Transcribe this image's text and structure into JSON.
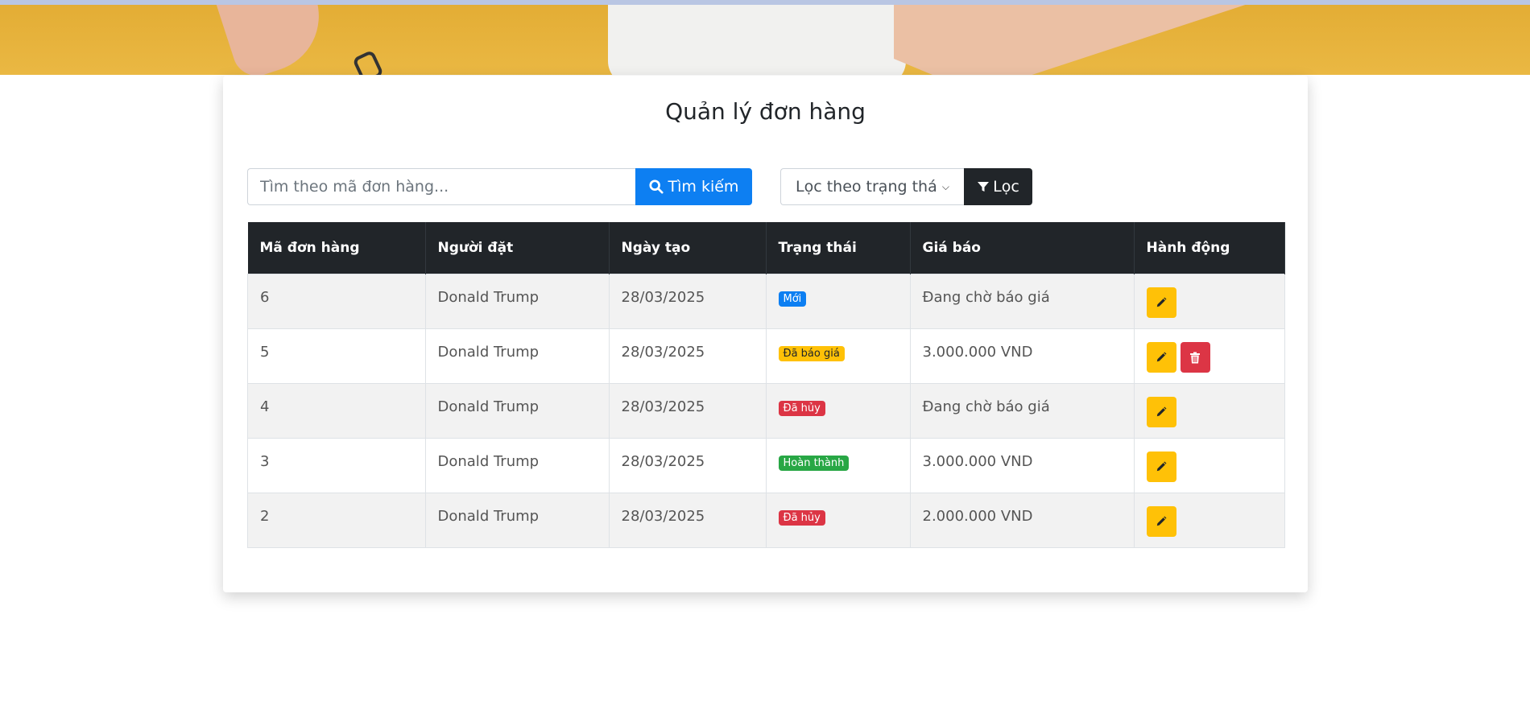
{
  "page": {
    "title": "Quản lý đơn hàng"
  },
  "search": {
    "placeholder": "Tìm theo mã đơn hàng...",
    "button_label": "Tìm kiếm",
    "icon": "search-icon"
  },
  "filter": {
    "selected": "Lọc theo trạng thái",
    "button_label": "Lọc",
    "icon": "filter-icon"
  },
  "table": {
    "headers": [
      "Mã đơn hàng",
      "Người đặt",
      "Ngày tạo",
      "Trạng thái",
      "Giá báo",
      "Hành động"
    ],
    "rows": [
      {
        "id": "6",
        "customer": "Donald Trump",
        "date": "28/03/2025",
        "status": "Mới",
        "status_color": "#0d7ff2",
        "status_text_color": "#ffffff",
        "price": "Đang chờ báo giá",
        "actions": [
          "edit"
        ]
      },
      {
        "id": "5",
        "customer": "Donald Trump",
        "date": "28/03/2025",
        "status": "Đã báo giá",
        "status_color": "#ffc107",
        "status_text_color": "#212529",
        "price": "3.000.000 VND",
        "actions": [
          "edit",
          "delete"
        ]
      },
      {
        "id": "4",
        "customer": "Donald Trump",
        "date": "28/03/2025",
        "status": "Đã hủy",
        "status_color": "#dc3545",
        "status_text_color": "#ffffff",
        "price": "Đang chờ báo giá",
        "actions": [
          "edit"
        ]
      },
      {
        "id": "3",
        "customer": "Donald Trump",
        "date": "28/03/2025",
        "status": "Hoàn thành",
        "status_color": "#28a745",
        "status_text_color": "#ffffff",
        "price": "3.000.000 VND",
        "actions": [
          "edit"
        ]
      },
      {
        "id": "2",
        "customer": "Donald Trump",
        "date": "28/03/2025",
        "status": "Đã hủy",
        "status_color": "#dc3545",
        "status_text_color": "#ffffff",
        "price": "2.000.000 VND",
        "actions": [
          "edit"
        ]
      }
    ]
  },
  "colors": {
    "primary": "#0d7ff2",
    "dark": "#212529",
    "warning": "#ffc107",
    "danger": "#dc3545",
    "success": "#28a745",
    "hero": "#e3ad35"
  }
}
